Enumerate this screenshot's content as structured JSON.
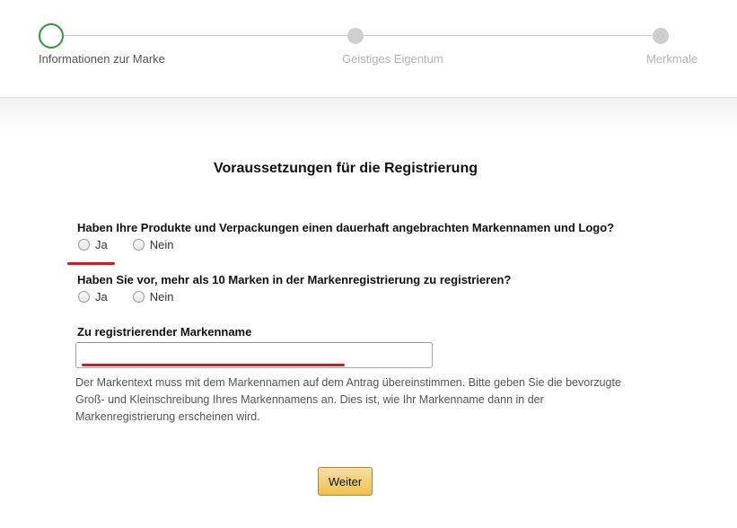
{
  "stepper": {
    "steps": [
      {
        "label": "Informationen zur Marke",
        "state": "active"
      },
      {
        "label": "Geistiges Eigentum",
        "state": "inactive"
      },
      {
        "label": "Merkmale",
        "state": "inactive"
      }
    ]
  },
  "form": {
    "title": "Voraussetzungen für die Registrierung",
    "question1": {
      "text": "Haben Ihre Produkte und Verpackungen einen dauerhaft angebrachten Markennamen und Logo?",
      "options": [
        "Ja",
        "Nein"
      ]
    },
    "question2": {
      "text": "Haben Sie vor, mehr als 10 Marken in der Markenregistrierung zu registrieren?",
      "options": [
        "Ja",
        "Nein"
      ]
    },
    "brand_field": {
      "label": "Zu registrierender Markenname",
      "value": "",
      "help": "Der Markentext muss mit dem Markennamen auf dem Antrag übereinstimmen. Bitte geben Sie die bevorzugte Groß- und Kleinschreibung Ihres Markennamens an. Dies ist, wie Ihr Markenname dann in der Markenregistrierung erscheinen wird."
    },
    "submit_label": "Weiter"
  },
  "colors": {
    "active_step": "#2b9a34",
    "annotation_red": "#d9161c",
    "button_yellow": "#f0c14b"
  }
}
